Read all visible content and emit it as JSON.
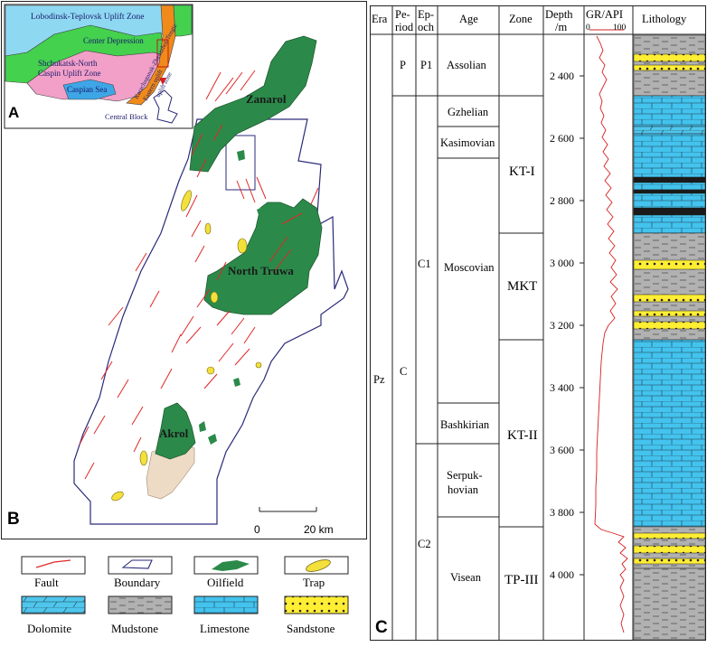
{
  "panels": {
    "a": {
      "letter": "A",
      "zones": [
        "Lobodinsk-Teplovsk Uplift Zone",
        "Center Depression",
        "Shchukatsk-North",
        "Caspin Uplift Zone",
        "Caspian Sea",
        "Karachaganak-Zhanazhol-Tengiz",
        "Eastern uplift",
        "uplift zone",
        "Central Block"
      ]
    },
    "b": {
      "letter": "B",
      "fields": [
        "Zanarol",
        "North Truwa",
        "Akrol"
      ],
      "scale": {
        "start": "0",
        "end": "20 km"
      }
    },
    "c": {
      "letter": "C"
    }
  },
  "legend": {
    "items": [
      {
        "label": "Fault",
        "icon": "fault-icon"
      },
      {
        "label": "Boundary",
        "icon": "boundary-icon"
      },
      {
        "label": "Oilfield",
        "icon": "oilfield-icon"
      },
      {
        "label": "Trap",
        "icon": "trap-icon"
      },
      {
        "label": "Dolomite",
        "icon": "dolomite-icon"
      },
      {
        "label": "Mudstone",
        "icon": "mudstone-icon"
      },
      {
        "label": "Limestone",
        "icon": "limestone-icon"
      },
      {
        "label": "Sandstone",
        "icon": "sandstone-icon"
      }
    ],
    "colors": {
      "dolomite": "#4fc6ec",
      "limestone": "#43c3ee",
      "mudstone": "#b1b1b1",
      "sandstone": "#ffee33",
      "oilfield": "#2b8a4a",
      "trap": "#f3e03a",
      "fault": "#e02828",
      "boundary": "#2a2a7a"
    }
  },
  "column": {
    "headers": {
      "era": "Era",
      "period_1": "Pe-",
      "period_2": "riod",
      "epoch_1": "Ep-",
      "epoch_2": "och",
      "age": "Age",
      "zone": "Zone",
      "depth_1": "Depth",
      "depth_2": "/m",
      "gr_1": "GR/API",
      "gr_min": "0",
      "gr_max": "100",
      "lith": "Lithology"
    },
    "era": "Pz",
    "periods": [
      "P",
      "C"
    ],
    "epochs": [
      "P1",
      "C1",
      "C2"
    ],
    "ages": [
      "Assolian",
      "Gzhelian",
      "Kasimovian",
      "Moscovian",
      "Bashkirian",
      "Serpuk-",
      "hovian",
      "Visean"
    ],
    "zones": [
      "KT-I",
      "MKT",
      "KT-II",
      "TP-III"
    ],
    "depth_ticks": [
      "2 400",
      "2 600",
      "2 800",
      "3 000",
      "3 200",
      "3 400",
      "3 600",
      "3 800",
      "4 000"
    ]
  }
}
